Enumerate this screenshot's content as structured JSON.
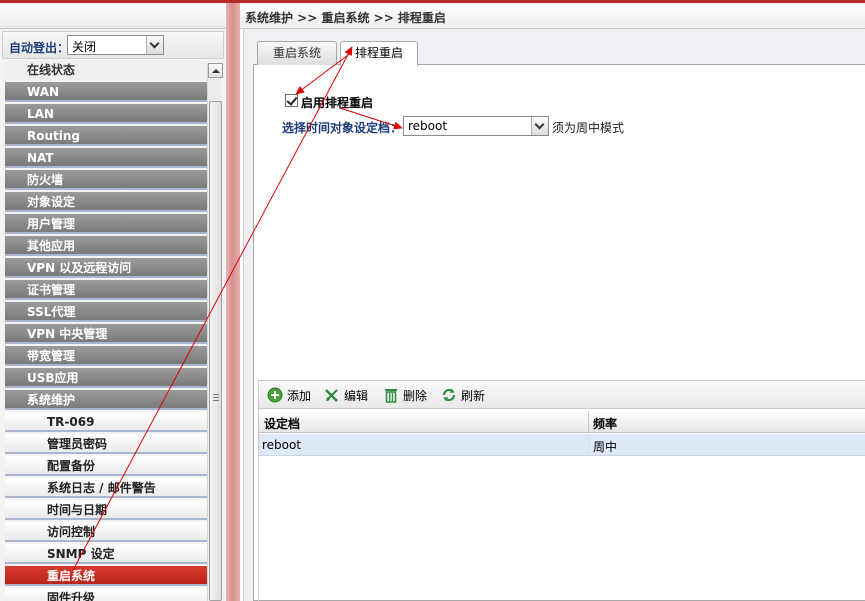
{
  "colors": {
    "accent_red": "#b9251b",
    "menu_dark": "#8a8a8a",
    "label_blue": "#1e3d7a",
    "annotation_arrow": "#e00000"
  },
  "sidebar": {
    "autologout_label": "自动登出：",
    "autologout_value": "关闭",
    "items": [
      {
        "label": "在线状态",
        "style": "first"
      },
      {
        "label": "WAN",
        "style": "dark"
      },
      {
        "label": "LAN",
        "style": "dark"
      },
      {
        "label": "Routing",
        "style": "dark"
      },
      {
        "label": "NAT",
        "style": "dark"
      },
      {
        "label": "防火墙",
        "style": "dark"
      },
      {
        "label": "对象设定",
        "style": "dark"
      },
      {
        "label": "用户管理",
        "style": "dark"
      },
      {
        "label": "其他应用",
        "style": "dark"
      },
      {
        "label": "VPN 以及远程访问",
        "style": "dark"
      },
      {
        "label": "证书管理",
        "style": "dark"
      },
      {
        "label": "SSL代理",
        "style": "dark"
      },
      {
        "label": "VPN 中央管理",
        "style": "dark"
      },
      {
        "label": "带宽管理",
        "style": "dark"
      },
      {
        "label": "USB应用",
        "style": "dark"
      },
      {
        "label": "系统维护",
        "style": "dark"
      },
      {
        "label": "TR-069",
        "style": "light"
      },
      {
        "label": "管理员密码",
        "style": "light"
      },
      {
        "label": "配置备份",
        "style": "light"
      },
      {
        "label": "系统日志 / 邮件警告",
        "style": "light"
      },
      {
        "label": "时间与日期",
        "style": "light"
      },
      {
        "label": "访问控制",
        "style": "light"
      },
      {
        "label": "SNMP 设定",
        "style": "light"
      },
      {
        "label": "重启系统",
        "style": "active"
      },
      {
        "label": "固件升级",
        "style": "light"
      }
    ]
  },
  "header": {
    "breadcrumb": "系统维护 >> 重启系统 >> 排程重启"
  },
  "tabs": [
    {
      "label": "重启系统"
    },
    {
      "label": "排程重启"
    }
  ],
  "form": {
    "enable_label": "启用排程重启",
    "enable_checked": true,
    "schedule_label": "选择时间对象设定档：",
    "schedule_value": "reboot",
    "mode_note": "须为周中模式"
  },
  "toolbar": {
    "add_label": "添加",
    "edit_label": "编辑",
    "delete_label": "删除",
    "refresh_label": "刷新",
    "icons": [
      "add-icon",
      "edit-icon",
      "delete-icon",
      "refresh-icon"
    ]
  },
  "grid": {
    "columns": [
      "设定档",
      "频率"
    ],
    "rows": [
      [
        "reboot",
        "周中"
      ]
    ]
  }
}
